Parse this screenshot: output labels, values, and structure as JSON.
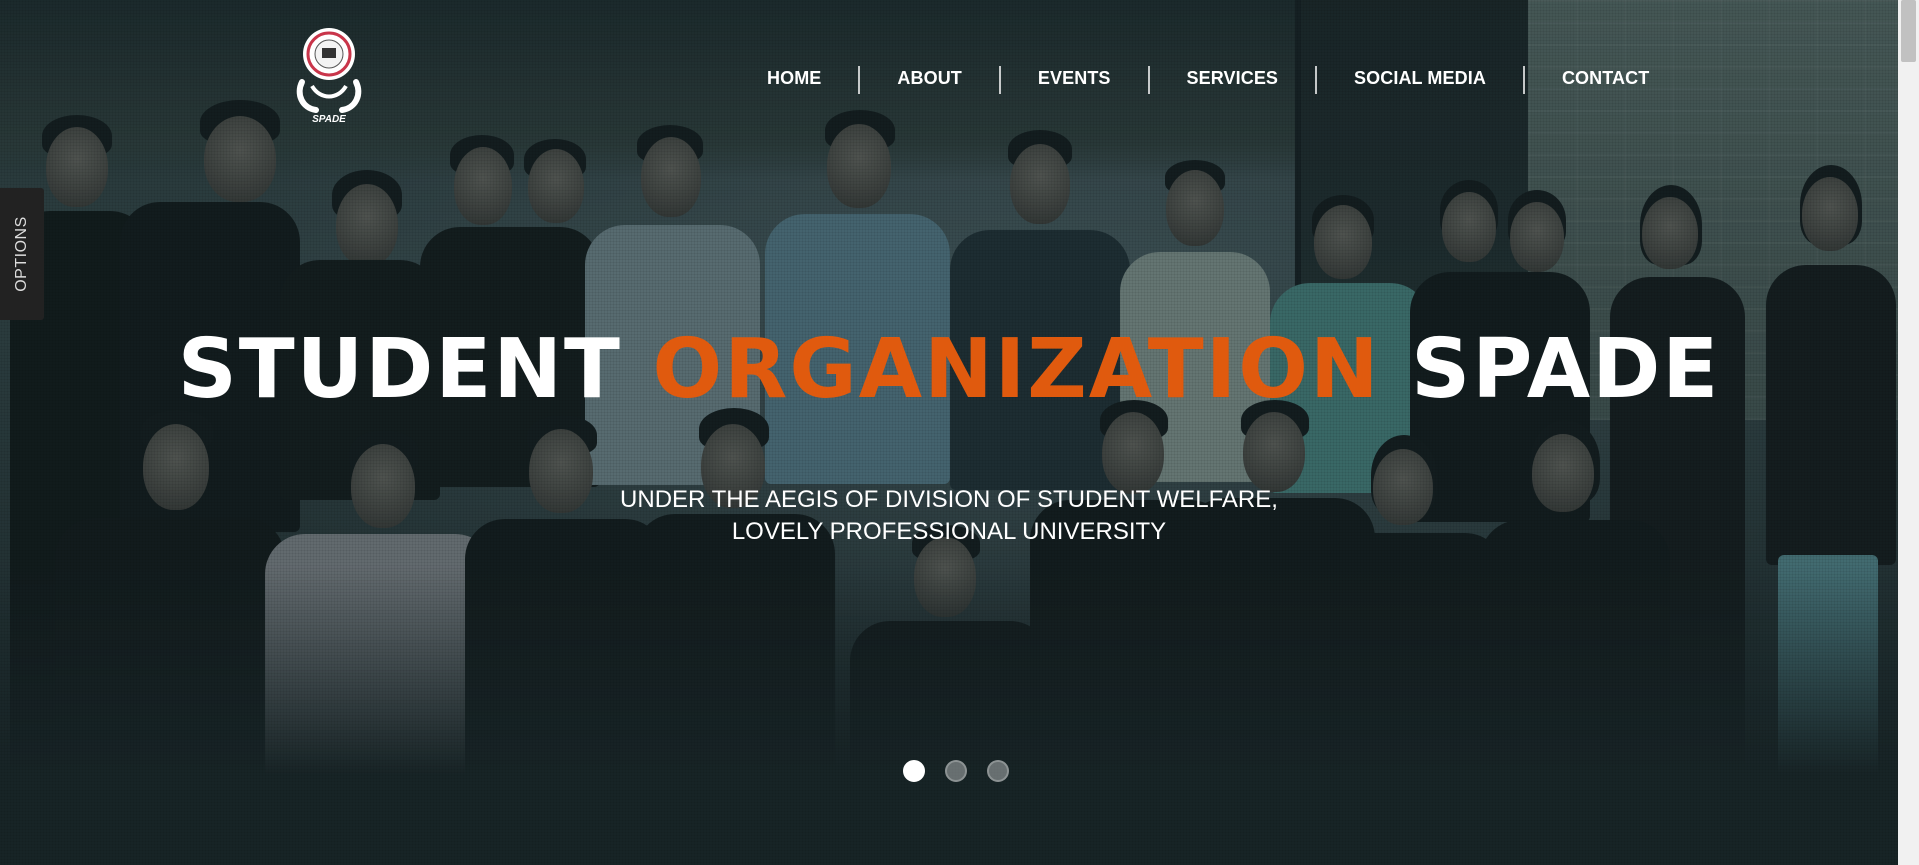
{
  "brand": {
    "logo_text": "SPADE"
  },
  "nav": {
    "items": [
      "HOME",
      "ABOUT",
      "EVENTS",
      "SERVICES",
      "SOCIAL MEDIA",
      "CONTACT"
    ]
  },
  "options_tab": {
    "label": "OPTIONS"
  },
  "hero": {
    "headline_part1": "STUDENT",
    "headline_accent": "ORGANIZATION",
    "headline_part3": "SPADE",
    "subtitle_line1": "UNDER THE AEGIS OF DIVISION OF STUDENT WELFARE,",
    "subtitle_line2": "LOVELY PROFESSIONAL UNIVERSITY",
    "accent_color": "#e05a0e"
  },
  "carousel": {
    "slide_count": 3,
    "active_index": 0
  }
}
